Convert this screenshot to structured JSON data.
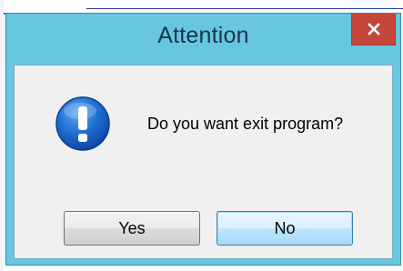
{
  "dialog": {
    "title": "Attention",
    "message": "Do you want exit program?",
    "close_glyph": "×",
    "icon": "info-icon",
    "buttons": {
      "yes_label": "Yes",
      "no_label": "No"
    }
  },
  "colors": {
    "frame": "#69c6df",
    "close_button": "#c7463b",
    "client_background": "#f0f0f0",
    "icon_blue": "#1f6fd3",
    "default_button": "#bee6fd"
  }
}
